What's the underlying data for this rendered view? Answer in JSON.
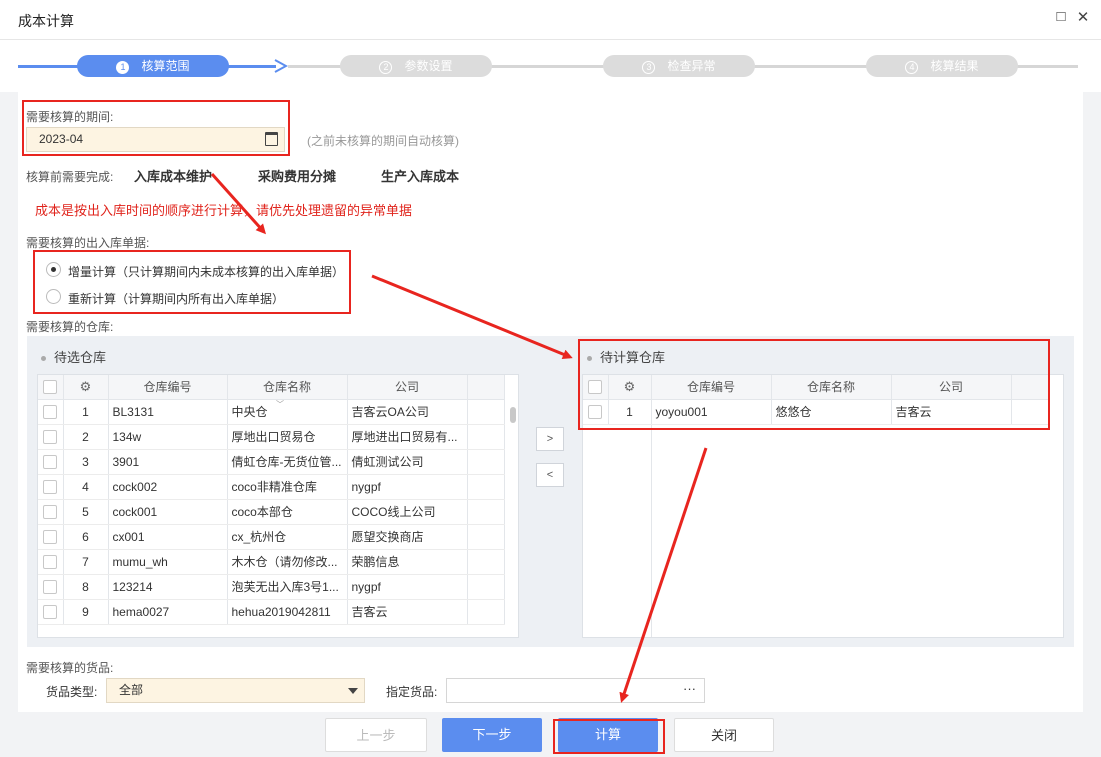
{
  "window": {
    "title": "成本计算",
    "maximize_icon": "□",
    "close_icon": "✕"
  },
  "steps": [
    {
      "num": "1",
      "label": "核算范围"
    },
    {
      "num": "2",
      "label": "参数设置"
    },
    {
      "num": "3",
      "label": "检查异常"
    },
    {
      "num": "4",
      "label": "核算结果"
    }
  ],
  "period": {
    "label": "需要核算的期间:",
    "value": "2023-04",
    "hint": "(之前未核算的期间自动核算)"
  },
  "prereq": {
    "label": "核算前需要完成:",
    "items": [
      "入库成本维护",
      "采购费用分摊",
      "生产入库成本"
    ]
  },
  "warning": "成本是按出入库时间的顺序进行计算，请优先处理遗留的异常单据",
  "bills": {
    "label": "需要核算的出入库单据:",
    "options": [
      {
        "label": "增量计算（只计算期间内未成本核算的出入库单据）",
        "checked": true
      },
      {
        "label": "重新计算（计算期间内所有出入库单据）",
        "checked": false
      }
    ]
  },
  "warehouse": {
    "label": "需要核算的仓库:",
    "left_title": "待选仓库",
    "right_title": "待计算仓库",
    "columns": [
      "仓库编号",
      "仓库名称",
      "公司"
    ],
    "available": [
      [
        "1",
        "BL3131",
        "中央仓",
        "吉客云OA公司"
      ],
      [
        "2",
        "134w",
        "厚地出口贸易仓",
        "厚地进出口贸易有..."
      ],
      [
        "3",
        "3901",
        "倩虹仓库-无货位管...",
        "倩虹测试公司"
      ],
      [
        "4",
        "cock002",
        "coco非精准仓库",
        "nygpf"
      ],
      [
        "5",
        "cock001",
        "coco本部仓",
        "COCO线上公司"
      ],
      [
        "6",
        "cx001",
        "cx_杭州仓",
        "愿望交换商店"
      ],
      [
        "7",
        "mumu_wh",
        "木木仓（请勿修改...",
        "荣鹏信息"
      ],
      [
        "8",
        "123214",
        "泡芙无出入库3号1...",
        "nygpf"
      ],
      [
        "9",
        "hema0027",
        "hehua2019042811",
        "吉客云"
      ]
    ],
    "selected": [
      [
        "1",
        "yoyou001",
        "悠悠仓",
        "吉客云"
      ]
    ],
    "move_right": ">",
    "move_left": "<"
  },
  "goods": {
    "label": "需要核算的货品:",
    "type_label": "货品类型:",
    "type_value": "全部",
    "spec_label": "指定货品:",
    "spec_value": "",
    "spec_button": "···"
  },
  "footer": {
    "prev": "上一步",
    "next": "下一步",
    "calc": "计算",
    "close": "关闭"
  },
  "colors": {
    "accent": "#5b8def",
    "annotation": "#e8251f",
    "input_bg": "#fdf4e2"
  }
}
